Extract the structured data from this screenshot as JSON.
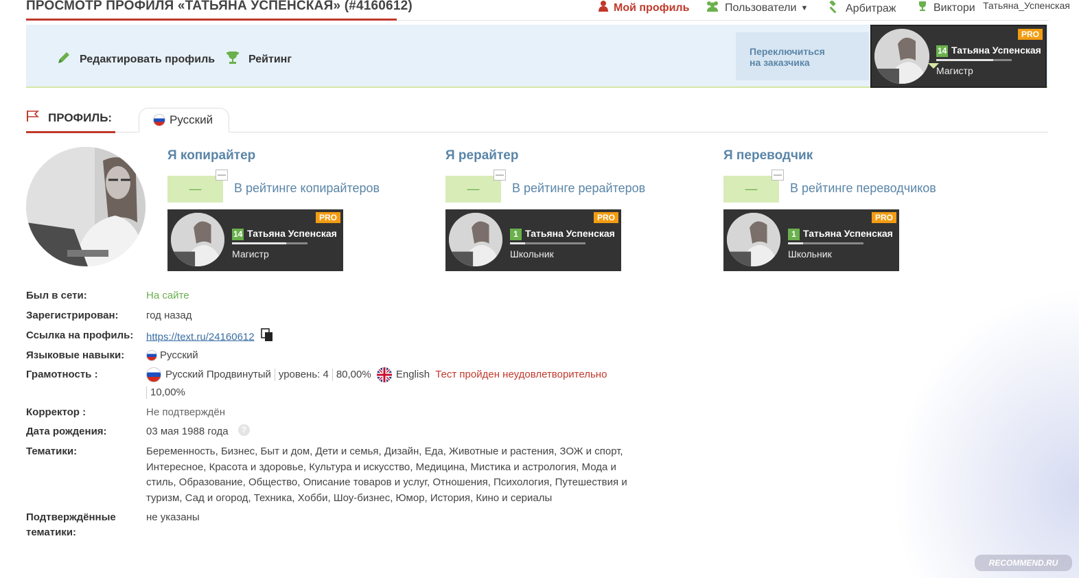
{
  "header": {
    "title": "ПРОСМОТР ПРОФИЛЯ «ТАТЬЯНА УСПЕНСКАЯ» (#4160612)",
    "nav": {
      "my_profile": "Мой профиль",
      "users": "Пользователи",
      "arbitration": "Арбитраж",
      "quizzes": "Виктори",
      "username": "Татьяна_Успенская"
    }
  },
  "panel": {
    "edit_profile": "Редактировать профиль",
    "rating": "Рейтинг",
    "switch_line1": "Переключиться",
    "switch_line2": "на заказчика",
    "user_card": {
      "level": "14",
      "name": "Татьяна Успенская",
      "rank": "Магистр",
      "pro": "PRO",
      "progress": 0.75
    }
  },
  "profile": {
    "heading": "ПРОФИЛЬ:",
    "language_tab": "Русский"
  },
  "roles": [
    {
      "title": "Я копирайтер",
      "score": "—",
      "link": "В рейтинге копирайтеров",
      "card": {
        "level": "14",
        "name": "Татьяна Успенская",
        "rank": "Магистр",
        "pro": "PRO",
        "progress": 0.72
      }
    },
    {
      "title": "Я рерайтер",
      "score": "—",
      "link": "В рейтинге рерайтеров",
      "card": {
        "level": "1",
        "name": "Татьяна Успенская",
        "rank": "Школьник",
        "pro": "PRO",
        "progress": 0.2
      }
    },
    {
      "title": "Я переводчик",
      "score": "—",
      "link": "В рейтинге переводчиков",
      "card": {
        "level": "1",
        "name": "Татьяна Успенская",
        "rank": "Школьник",
        "pro": "PRO",
        "progress": 0.2
      }
    }
  ],
  "info": {
    "online_label": "Был в сети:",
    "online_value": "На сайте",
    "registered_label": "Зарегистрирован:",
    "registered_value": "год назад",
    "link_label": "Ссылка на профиль:",
    "link_value": "https://text.ru/24160612",
    "langs_label": "Языковые навыки:",
    "langs_value": "Русский",
    "literacy_label": "Грамотность :",
    "literacy_ru": "Русский Продвинутый",
    "literacy_level": "уровень: 4",
    "literacy_ru_pct": "80,00%",
    "literacy_en": "English",
    "literacy_en_result": "Тест пройден неудовлетворительно",
    "literacy_en_pct": "10,00%",
    "corrector_label": "Корректор :",
    "corrector_value": "Не подтверждён",
    "birthday_label": "Дата рождения:",
    "birthday_value": "03 мая 1988 года",
    "topics_label": "Тематики:",
    "topics_line1": "Беременность, Бизнес, Быт и дом, Дети и семья, Дизайн, Еда, Животные и растения, ЗОЖ и спорт,",
    "topics_line2": "Интересное, Красота и здоровье, Культура и искусство, Медицина, Мистика и астрология, Мода и",
    "topics_line3": "стиль, Образование, Общество, Описание товаров и услуг, Отношения, Психология, Путешествия и",
    "topics_line4": "туризм, Сад и огород, Техника, Хобби, Шоу-бизнес, Юмор, История, Кино и сериалы",
    "confirmed_label1": "Подтверждённые",
    "confirmed_label2": "тематики:",
    "confirmed_value": "не указаны"
  },
  "watermark": "RECOMMEND.RU",
  "colors": {
    "accent_red": "#c0392b",
    "link_blue": "#5a85a8",
    "green": "#6ab04c",
    "pro_orange": "#f39c12"
  }
}
